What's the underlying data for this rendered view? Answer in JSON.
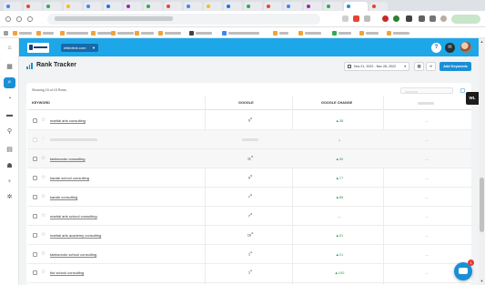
{
  "header": {
    "account_label": "elitedeck.com",
    "help_label": "?",
    "notifications_label": "✉"
  },
  "page": {
    "title": "Rank Tracker",
    "date_range": "Nov 21, 2022 - Nov 28, 2022",
    "add_keywords_label": "Add Keywords"
  },
  "table": {
    "showing_text": "Showing 15 of 15 Rows",
    "columns": {
      "keyword": "KEYWORD",
      "google": "GOOGLE",
      "google_change": "GOOGLE CHANGE"
    },
    "rows": [
      {
        "keyword": "martial arts consulting",
        "rank": "9",
        "suffix": "th",
        "change": "▲38"
      },
      {
        "keyword": "",
        "rank": "",
        "suffix": "",
        "change": "▲"
      },
      {
        "keyword": "taekwondo consulting",
        "rank": "11",
        "suffix": "th",
        "change": "▲90"
      },
      {
        "keyword": "karate school consulting",
        "rank": "9",
        "suffix": "th",
        "change": "▲77"
      },
      {
        "keyword": "karate consulting",
        "rank": "7",
        "suffix": "th",
        "change": "▲85"
      },
      {
        "keyword": "martial arts school consulting",
        "rank": "7",
        "suffix": "th",
        "change": "—"
      },
      {
        "keyword": "martial arts academy consulting",
        "rank": "10",
        "suffix": "th",
        "change": "▲51"
      },
      {
        "keyword": "taekwondo school consulting",
        "rank": "1",
        "suffix": "st",
        "change": "▲21"
      },
      {
        "keyword": "tkd school consulting",
        "rank": "1",
        "suffix": "st",
        "change": "▲100"
      }
    ],
    "placeholder_dash": "—"
  },
  "side_tab_label": "WL",
  "chat_badge": "1",
  "colors": {
    "accent": "#1a8fd6",
    "header": "#1ea7e8",
    "positive": "#2e9a4a"
  }
}
